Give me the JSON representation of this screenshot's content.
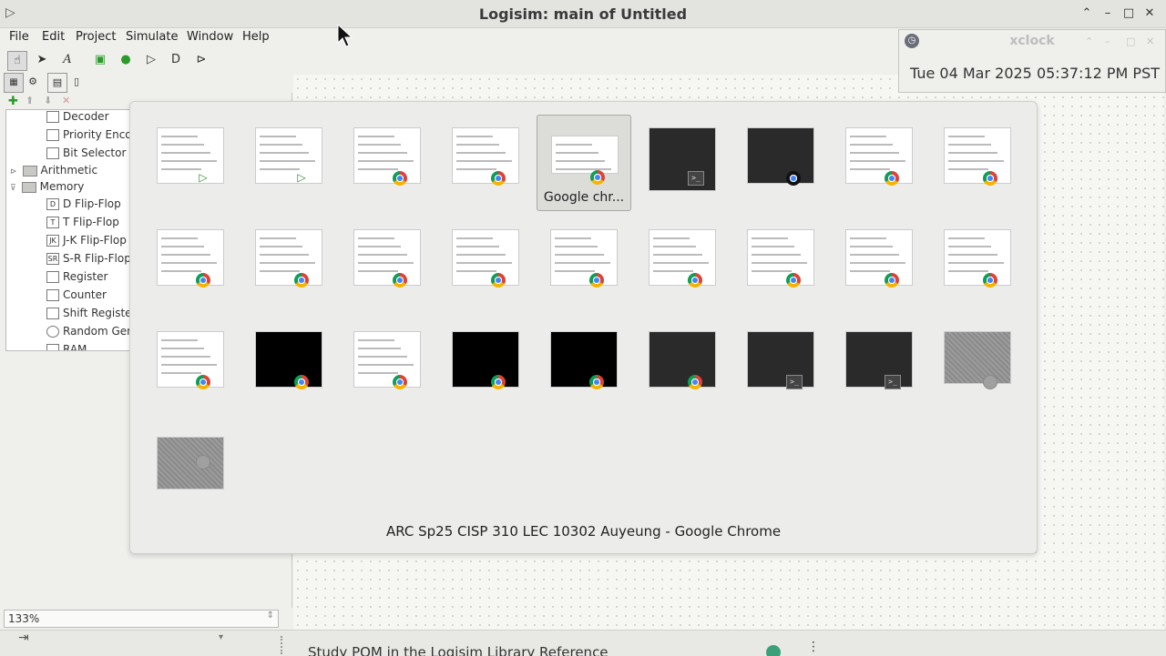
{
  "window": {
    "title": "Logisim: main of Untitled",
    "controls": [
      "chevron-up-icon",
      "minimize-icon",
      "maximize-icon",
      "close-icon"
    ]
  },
  "menubar": {
    "items": [
      "File",
      "Edit",
      "Project",
      "Simulate",
      "Window",
      "Help"
    ]
  },
  "toolbar": {
    "tools": [
      "hand-poke-icon",
      "arrow-select-icon",
      "text-tool-icon",
      "input-pin-icon",
      "output-pin-icon",
      "not-gate-icon",
      "and-gate-icon",
      "or-gate-icon"
    ]
  },
  "tree": {
    "items": [
      {
        "label": "Decoder",
        "kind": "component"
      },
      {
        "label": "Priority Enco",
        "kind": "component"
      },
      {
        "label": "Bit Selector",
        "kind": "component"
      },
      {
        "label": "Arithmetic",
        "kind": "folder"
      },
      {
        "label": "Memory",
        "kind": "folder"
      },
      {
        "label": "D Flip-Flop",
        "kind": "component"
      },
      {
        "label": "T Flip-Flop",
        "kind": "component"
      },
      {
        "label": "J-K Flip-Flop",
        "kind": "component"
      },
      {
        "label": "S-R Flip-Flop",
        "kind": "component"
      },
      {
        "label": "Register",
        "kind": "component"
      },
      {
        "label": "Counter",
        "kind": "component"
      },
      {
        "label": "Shift Register",
        "kind": "component"
      },
      {
        "label": "Random Gen",
        "kind": "component"
      },
      {
        "label": "RAM",
        "kind": "component"
      }
    ]
  },
  "zoom": "133%",
  "xclock": {
    "title": "xclock",
    "time": "Tue 04 Mar 2025 05:37:12 PM PST"
  },
  "switcher": {
    "selected_label": "Google chr...",
    "caption": "ARC Sp25 CISP 310 LEC 10302 Auyeung - Google Chrome",
    "windows": [
      {
        "style": "light",
        "icon": "logisim"
      },
      {
        "style": "light",
        "icon": "logisim"
      },
      {
        "style": "light",
        "icon": "chrome"
      },
      {
        "style": "light",
        "icon": "chrome"
      },
      {
        "style": "light",
        "icon": "chrome",
        "selected": true
      },
      {
        "style": "dark",
        "icon": "terminal"
      },
      {
        "style": "dark",
        "icon": "other"
      },
      {
        "style": "light",
        "icon": "chrome"
      },
      {
        "style": "light",
        "icon": "chrome"
      },
      {
        "style": "light",
        "icon": "chrome"
      },
      {
        "style": "light",
        "icon": "chrome"
      },
      {
        "style": "light",
        "icon": "chrome"
      },
      {
        "style": "light",
        "icon": "chrome"
      },
      {
        "style": "light",
        "icon": "chrome"
      },
      {
        "style": "light",
        "icon": "chrome"
      },
      {
        "style": "light",
        "icon": "chrome"
      },
      {
        "style": "light",
        "icon": "chrome"
      },
      {
        "style": "light",
        "icon": "chrome"
      },
      {
        "style": "light",
        "icon": "chrome"
      },
      {
        "style": "black",
        "icon": "chrome"
      },
      {
        "style": "light",
        "icon": "chrome"
      },
      {
        "style": "black",
        "icon": "chrome"
      },
      {
        "style": "black",
        "icon": "chrome"
      },
      {
        "style": "dark",
        "icon": "chrome"
      },
      {
        "style": "dark",
        "icon": "terminal"
      },
      {
        "style": "dark",
        "icon": "terminal"
      },
      {
        "style": "gray",
        "icon": "gray"
      },
      {
        "style": "gray",
        "icon": "gray"
      }
    ]
  },
  "taskbar": {
    "label": "Study POM in the Logisim Library Reference"
  }
}
